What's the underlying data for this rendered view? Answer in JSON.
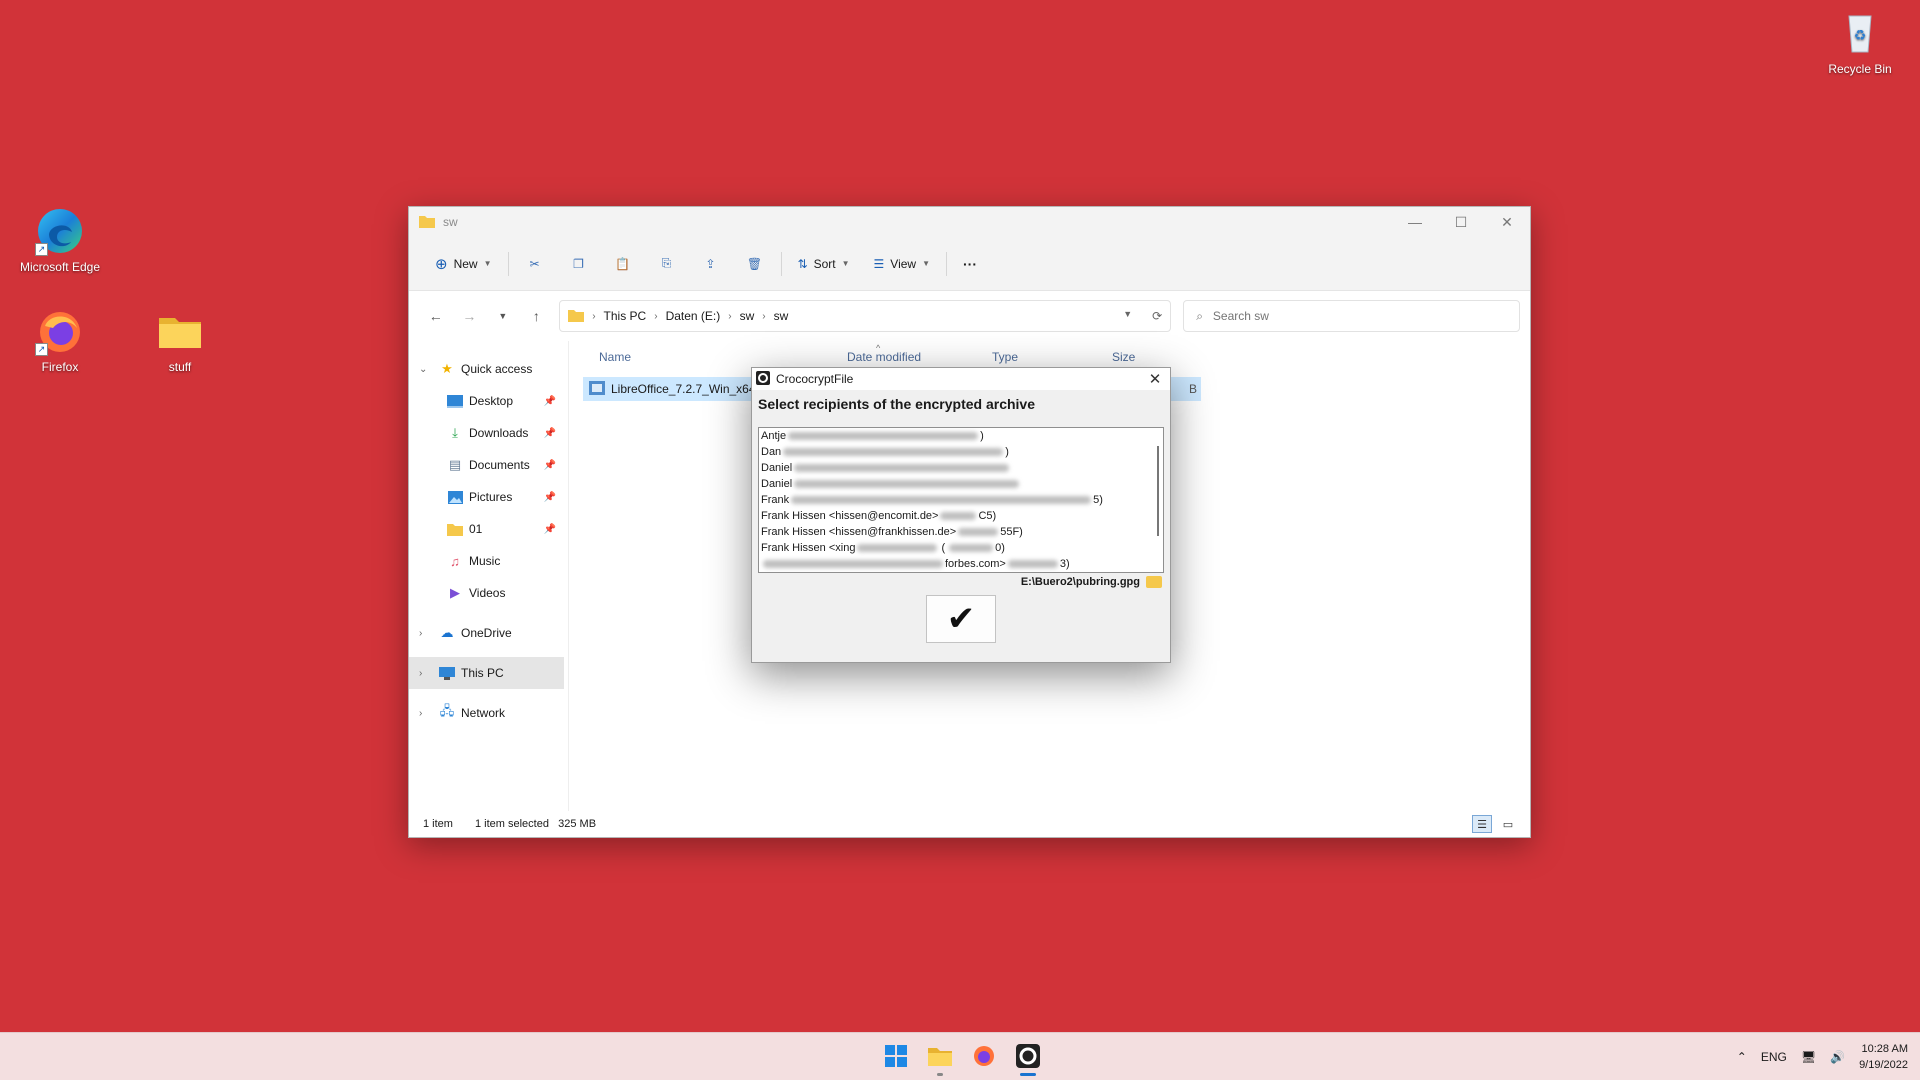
{
  "desktop": {
    "icons": [
      {
        "label": "Microsoft Edge"
      },
      {
        "label": "Firefox"
      },
      {
        "label": "stuff"
      },
      {
        "label": "Recycle Bin"
      }
    ]
  },
  "explorer": {
    "title": "sw",
    "toolbar": {
      "new_label": "New",
      "sort_label": "Sort",
      "view_label": "View",
      "more_label": "···"
    },
    "breadcrumb": [
      "This PC",
      "Daten (E:)",
      "sw",
      "sw"
    ],
    "search_placeholder": "Search sw",
    "nav": {
      "quick_access": "Quick access",
      "desktop": "Desktop",
      "downloads": "Downloads",
      "documents": "Documents",
      "pictures": "Pictures",
      "folder_01": "01",
      "music": "Music",
      "videos": "Videos",
      "onedrive": "OneDrive",
      "this_pc": "This PC",
      "network": "Network"
    },
    "columns": {
      "name": "Name",
      "date_modified": "Date modified",
      "type": "Type",
      "size": "Size"
    },
    "files": [
      {
        "name": "LibreOffice_7.2.7_Win_x64",
        "size_tail": "B"
      }
    ],
    "status": {
      "count": "1 item",
      "selection": "1 item selected",
      "size": "325 MB"
    }
  },
  "dialog": {
    "title": "CrococryptFile",
    "heading": "Select recipients of the encrypted archive",
    "recipients": [
      {
        "prefix": "Antje",
        "suffix": ")"
      },
      {
        "prefix": "Dan",
        "suffix": ")"
      },
      {
        "prefix": "Daniel",
        "suffix": ""
      },
      {
        "prefix": "Daniel",
        "suffix": ""
      },
      {
        "prefix": "Frank",
        "suffix": "5)"
      },
      {
        "prefix": "Frank Hissen <hissen@encomit.de>",
        "suffix": "C5)"
      },
      {
        "prefix": "Frank Hissen <hissen@frankhissen.de>",
        "suffix": "55F)"
      },
      {
        "prefix": "Frank Hissen <xing",
        "suffix": "0)"
      },
      {
        "prefix": "",
        "suffix": "forbes.com>"
      }
    ],
    "keyring_path": "E:\\Buero2\\pubring.gpg",
    "ok_symbol": "✔"
  },
  "taskbar": {
    "language": "ENG",
    "time": "10:28 AM",
    "date": "9/19/2022"
  }
}
